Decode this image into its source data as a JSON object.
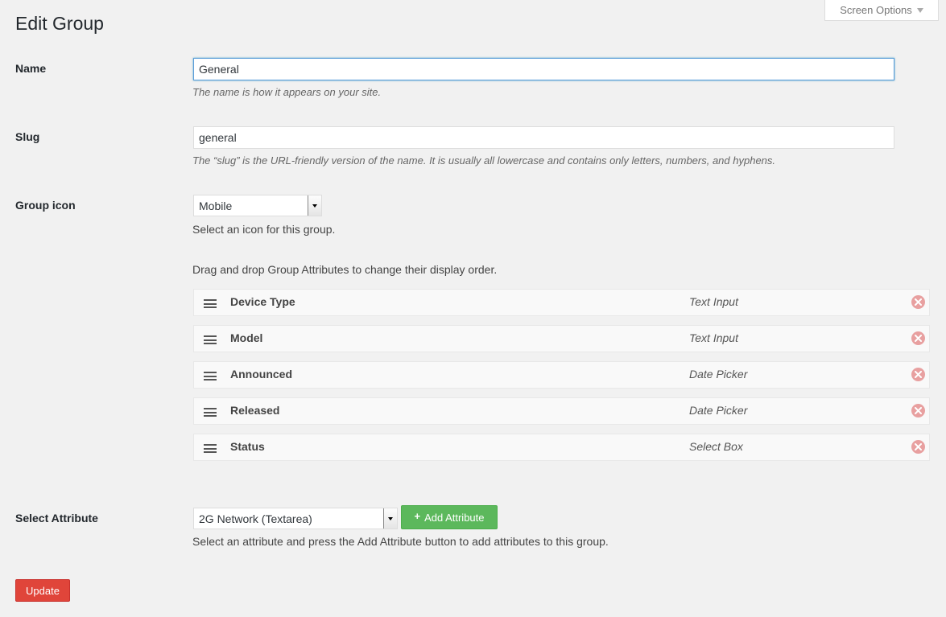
{
  "screen_options": {
    "label": "Screen Options",
    "icon": "triangle-down-icon"
  },
  "page": {
    "title": "Edit Group"
  },
  "name": {
    "label": "Name",
    "value": "General",
    "description": "The name is how it appears on your site."
  },
  "slug": {
    "label": "Slug",
    "value": "general",
    "description": "The “slug” is the URL-friendly version of the name. It is usually all lowercase and contains only letters, numbers, and hyphens."
  },
  "group_icon": {
    "label": "Group icon",
    "selected": "Mobile",
    "description": "Select an icon for this group."
  },
  "attributes": {
    "instructions": "Drag and drop Group Attributes to change their display order.",
    "items": [
      {
        "name": "Device Type",
        "type": "Text Input"
      },
      {
        "name": "Model",
        "type": "Text Input"
      },
      {
        "name": "Announced",
        "type": "Date Picker"
      },
      {
        "name": "Released",
        "type": "Date Picker"
      },
      {
        "name": "Status",
        "type": "Select Box"
      }
    ]
  },
  "select_attribute": {
    "label": "Select Attribute",
    "selected": "2G Network (Textarea)",
    "add_button": "Add Attribute",
    "description": "Select an attribute and press the Add Attribute button to add attributes to this group."
  },
  "update_button": "Update",
  "colors": {
    "background": "#f1f1f1",
    "add_button": "#5cb85c",
    "update_button": "#e0453a",
    "focus_border": "#5b9dd9",
    "remove_icon": "#e8a0a0"
  }
}
